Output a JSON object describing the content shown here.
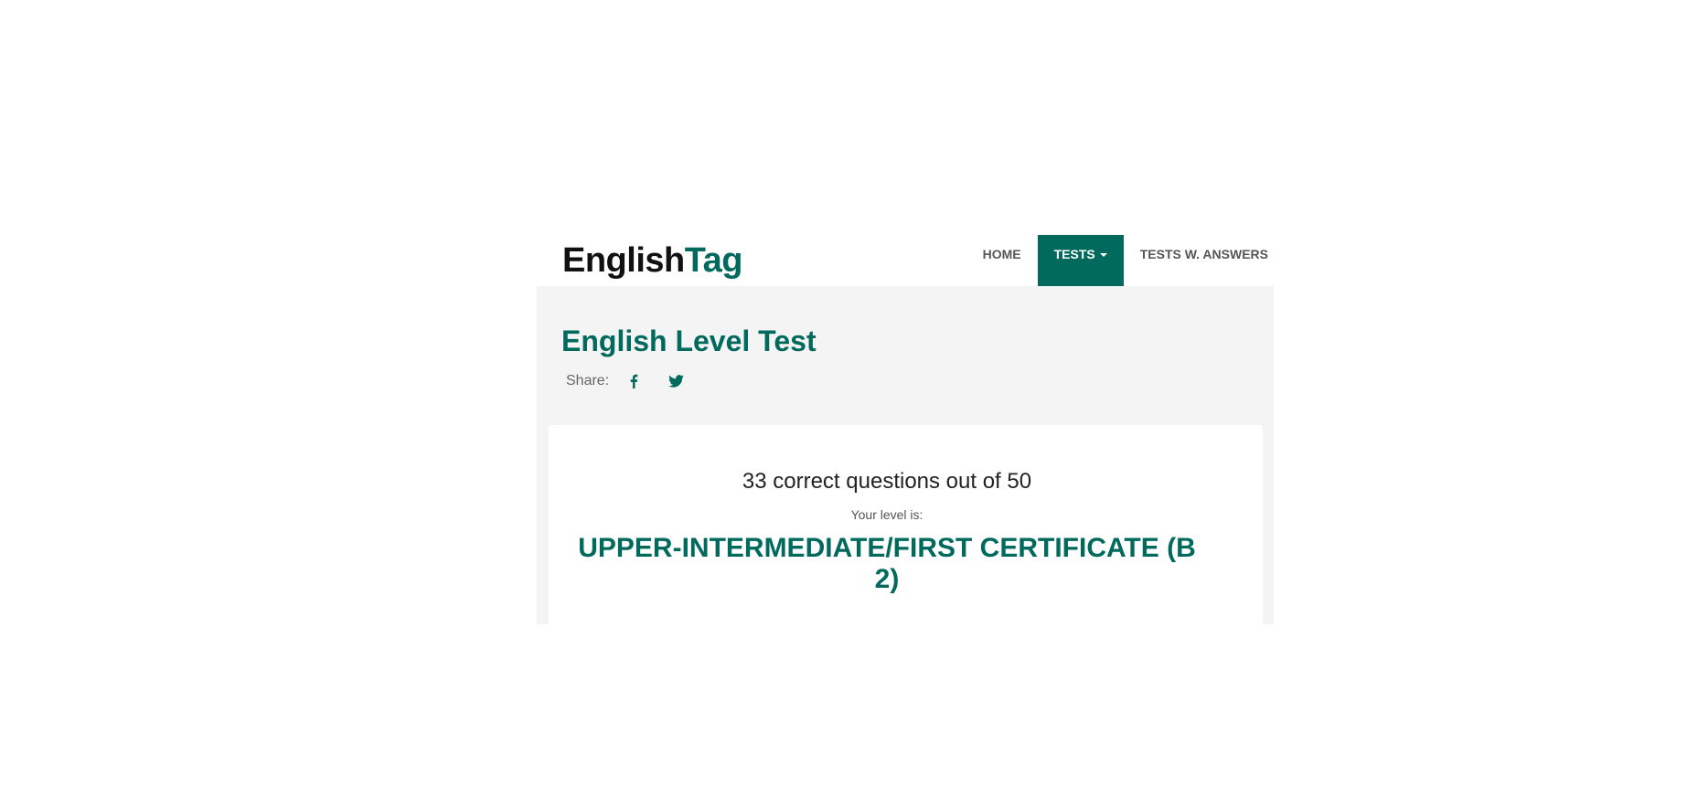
{
  "logo": {
    "part_a": "English",
    "part_b": "Tag"
  },
  "nav": {
    "items": [
      {
        "label": "HOME",
        "active": false
      },
      {
        "label": "TESTS",
        "active": true,
        "has_dropdown": true
      },
      {
        "label": "TESTS W. ANSWERS",
        "active": false
      }
    ]
  },
  "page": {
    "title": "English Level Test",
    "share_label": "Share:",
    "share_icons": [
      "facebook-icon",
      "twitter-icon"
    ]
  },
  "result": {
    "score_text": "33 correct questions out of 50",
    "level_label": "Your level is:",
    "level_value": "UPPER-INTERMEDIATE/FIRST CERTIFICATE (B 2)"
  },
  "colors": {
    "brand": "#016a5d",
    "panel_bg": "#f4f4f4",
    "text_dark": "#111111",
    "nav_text": "#555555"
  }
}
